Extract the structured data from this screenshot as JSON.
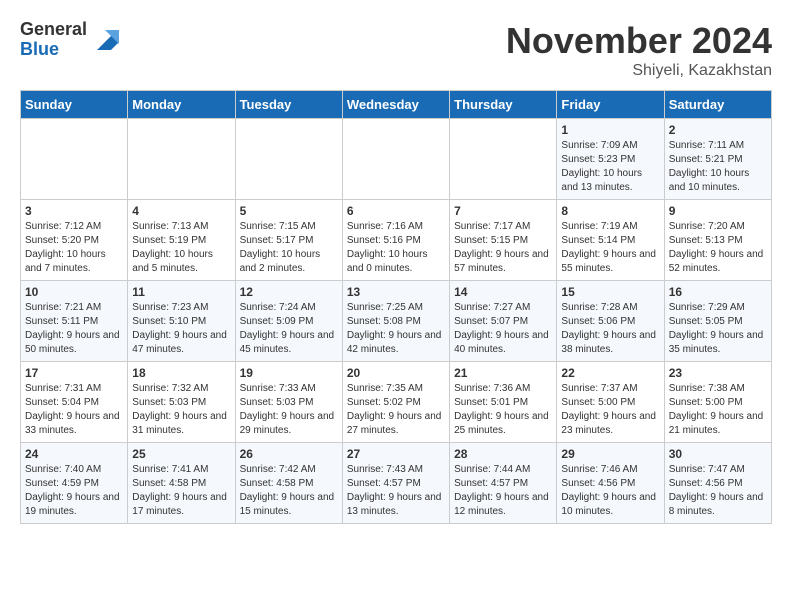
{
  "logo": {
    "general": "General",
    "blue": "Blue"
  },
  "title": "November 2024",
  "subtitle": "Shiyeli, Kazakhstan",
  "headers": [
    "Sunday",
    "Monday",
    "Tuesday",
    "Wednesday",
    "Thursday",
    "Friday",
    "Saturday"
  ],
  "weeks": [
    [
      {
        "day": "",
        "info": ""
      },
      {
        "day": "",
        "info": ""
      },
      {
        "day": "",
        "info": ""
      },
      {
        "day": "",
        "info": ""
      },
      {
        "day": "",
        "info": ""
      },
      {
        "day": "1",
        "info": "Sunrise: 7:09 AM\nSunset: 5:23 PM\nDaylight: 10 hours and 13 minutes."
      },
      {
        "day": "2",
        "info": "Sunrise: 7:11 AM\nSunset: 5:21 PM\nDaylight: 10 hours and 10 minutes."
      }
    ],
    [
      {
        "day": "3",
        "info": "Sunrise: 7:12 AM\nSunset: 5:20 PM\nDaylight: 10 hours and 7 minutes."
      },
      {
        "day": "4",
        "info": "Sunrise: 7:13 AM\nSunset: 5:19 PM\nDaylight: 10 hours and 5 minutes."
      },
      {
        "day": "5",
        "info": "Sunrise: 7:15 AM\nSunset: 5:17 PM\nDaylight: 10 hours and 2 minutes."
      },
      {
        "day": "6",
        "info": "Sunrise: 7:16 AM\nSunset: 5:16 PM\nDaylight: 10 hours and 0 minutes."
      },
      {
        "day": "7",
        "info": "Sunrise: 7:17 AM\nSunset: 5:15 PM\nDaylight: 9 hours and 57 minutes."
      },
      {
        "day": "8",
        "info": "Sunrise: 7:19 AM\nSunset: 5:14 PM\nDaylight: 9 hours and 55 minutes."
      },
      {
        "day": "9",
        "info": "Sunrise: 7:20 AM\nSunset: 5:13 PM\nDaylight: 9 hours and 52 minutes."
      }
    ],
    [
      {
        "day": "10",
        "info": "Sunrise: 7:21 AM\nSunset: 5:11 PM\nDaylight: 9 hours and 50 minutes."
      },
      {
        "day": "11",
        "info": "Sunrise: 7:23 AM\nSunset: 5:10 PM\nDaylight: 9 hours and 47 minutes."
      },
      {
        "day": "12",
        "info": "Sunrise: 7:24 AM\nSunset: 5:09 PM\nDaylight: 9 hours and 45 minutes."
      },
      {
        "day": "13",
        "info": "Sunrise: 7:25 AM\nSunset: 5:08 PM\nDaylight: 9 hours and 42 minutes."
      },
      {
        "day": "14",
        "info": "Sunrise: 7:27 AM\nSunset: 5:07 PM\nDaylight: 9 hours and 40 minutes."
      },
      {
        "day": "15",
        "info": "Sunrise: 7:28 AM\nSunset: 5:06 PM\nDaylight: 9 hours and 38 minutes."
      },
      {
        "day": "16",
        "info": "Sunrise: 7:29 AM\nSunset: 5:05 PM\nDaylight: 9 hours and 35 minutes."
      }
    ],
    [
      {
        "day": "17",
        "info": "Sunrise: 7:31 AM\nSunset: 5:04 PM\nDaylight: 9 hours and 33 minutes."
      },
      {
        "day": "18",
        "info": "Sunrise: 7:32 AM\nSunset: 5:03 PM\nDaylight: 9 hours and 31 minutes."
      },
      {
        "day": "19",
        "info": "Sunrise: 7:33 AM\nSunset: 5:03 PM\nDaylight: 9 hours and 29 minutes."
      },
      {
        "day": "20",
        "info": "Sunrise: 7:35 AM\nSunset: 5:02 PM\nDaylight: 9 hours and 27 minutes."
      },
      {
        "day": "21",
        "info": "Sunrise: 7:36 AM\nSunset: 5:01 PM\nDaylight: 9 hours and 25 minutes."
      },
      {
        "day": "22",
        "info": "Sunrise: 7:37 AM\nSunset: 5:00 PM\nDaylight: 9 hours and 23 minutes."
      },
      {
        "day": "23",
        "info": "Sunrise: 7:38 AM\nSunset: 5:00 PM\nDaylight: 9 hours and 21 minutes."
      }
    ],
    [
      {
        "day": "24",
        "info": "Sunrise: 7:40 AM\nSunset: 4:59 PM\nDaylight: 9 hours and 19 minutes."
      },
      {
        "day": "25",
        "info": "Sunrise: 7:41 AM\nSunset: 4:58 PM\nDaylight: 9 hours and 17 minutes."
      },
      {
        "day": "26",
        "info": "Sunrise: 7:42 AM\nSunset: 4:58 PM\nDaylight: 9 hours and 15 minutes."
      },
      {
        "day": "27",
        "info": "Sunrise: 7:43 AM\nSunset: 4:57 PM\nDaylight: 9 hours and 13 minutes."
      },
      {
        "day": "28",
        "info": "Sunrise: 7:44 AM\nSunset: 4:57 PM\nDaylight: 9 hours and 12 minutes."
      },
      {
        "day": "29",
        "info": "Sunrise: 7:46 AM\nSunset: 4:56 PM\nDaylight: 9 hours and 10 minutes."
      },
      {
        "day": "30",
        "info": "Sunrise: 7:47 AM\nSunset: 4:56 PM\nDaylight: 9 hours and 8 minutes."
      }
    ]
  ]
}
